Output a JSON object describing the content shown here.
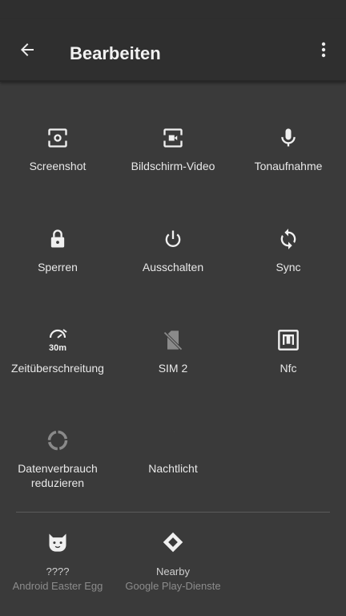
{
  "header": {
    "title": "Bearbeiten",
    "back_icon": "arrow-back-icon",
    "menu_icon": "more-vert-icon"
  },
  "tiles": [
    {
      "label": "Screenshot",
      "icon": "screenshot-icon"
    },
    {
      "label": "Bildschirm-Video",
      "icon": "screen-record-icon"
    },
    {
      "label": "Tonaufnahme",
      "icon": "microphone-icon"
    },
    {
      "label": "Sperren",
      "icon": "lock-icon"
    },
    {
      "label": "Ausschalten",
      "icon": "power-icon"
    },
    {
      "label": "Sync",
      "icon": "sync-icon"
    },
    {
      "label": "Zeitüberschreitung",
      "icon": "timeout-icon",
      "icon_text": "30m"
    },
    {
      "label": "SIM 2",
      "icon": "sim-off-icon"
    },
    {
      "label": "Nfc",
      "icon": "nfc-icon"
    },
    {
      "label": "Datenverbrauch reduzieren",
      "icon": "data-saver-icon"
    },
    {
      "label": "Nachtlicht",
      "icon": "night-light-icon"
    }
  ],
  "available_tiles": [
    {
      "title": "????",
      "subtitle": "Android Easter Egg",
      "icon": "cat-icon"
    },
    {
      "title": "Nearby",
      "subtitle": "Google Play-Dienste",
      "icon": "nearby-icon"
    }
  ]
}
